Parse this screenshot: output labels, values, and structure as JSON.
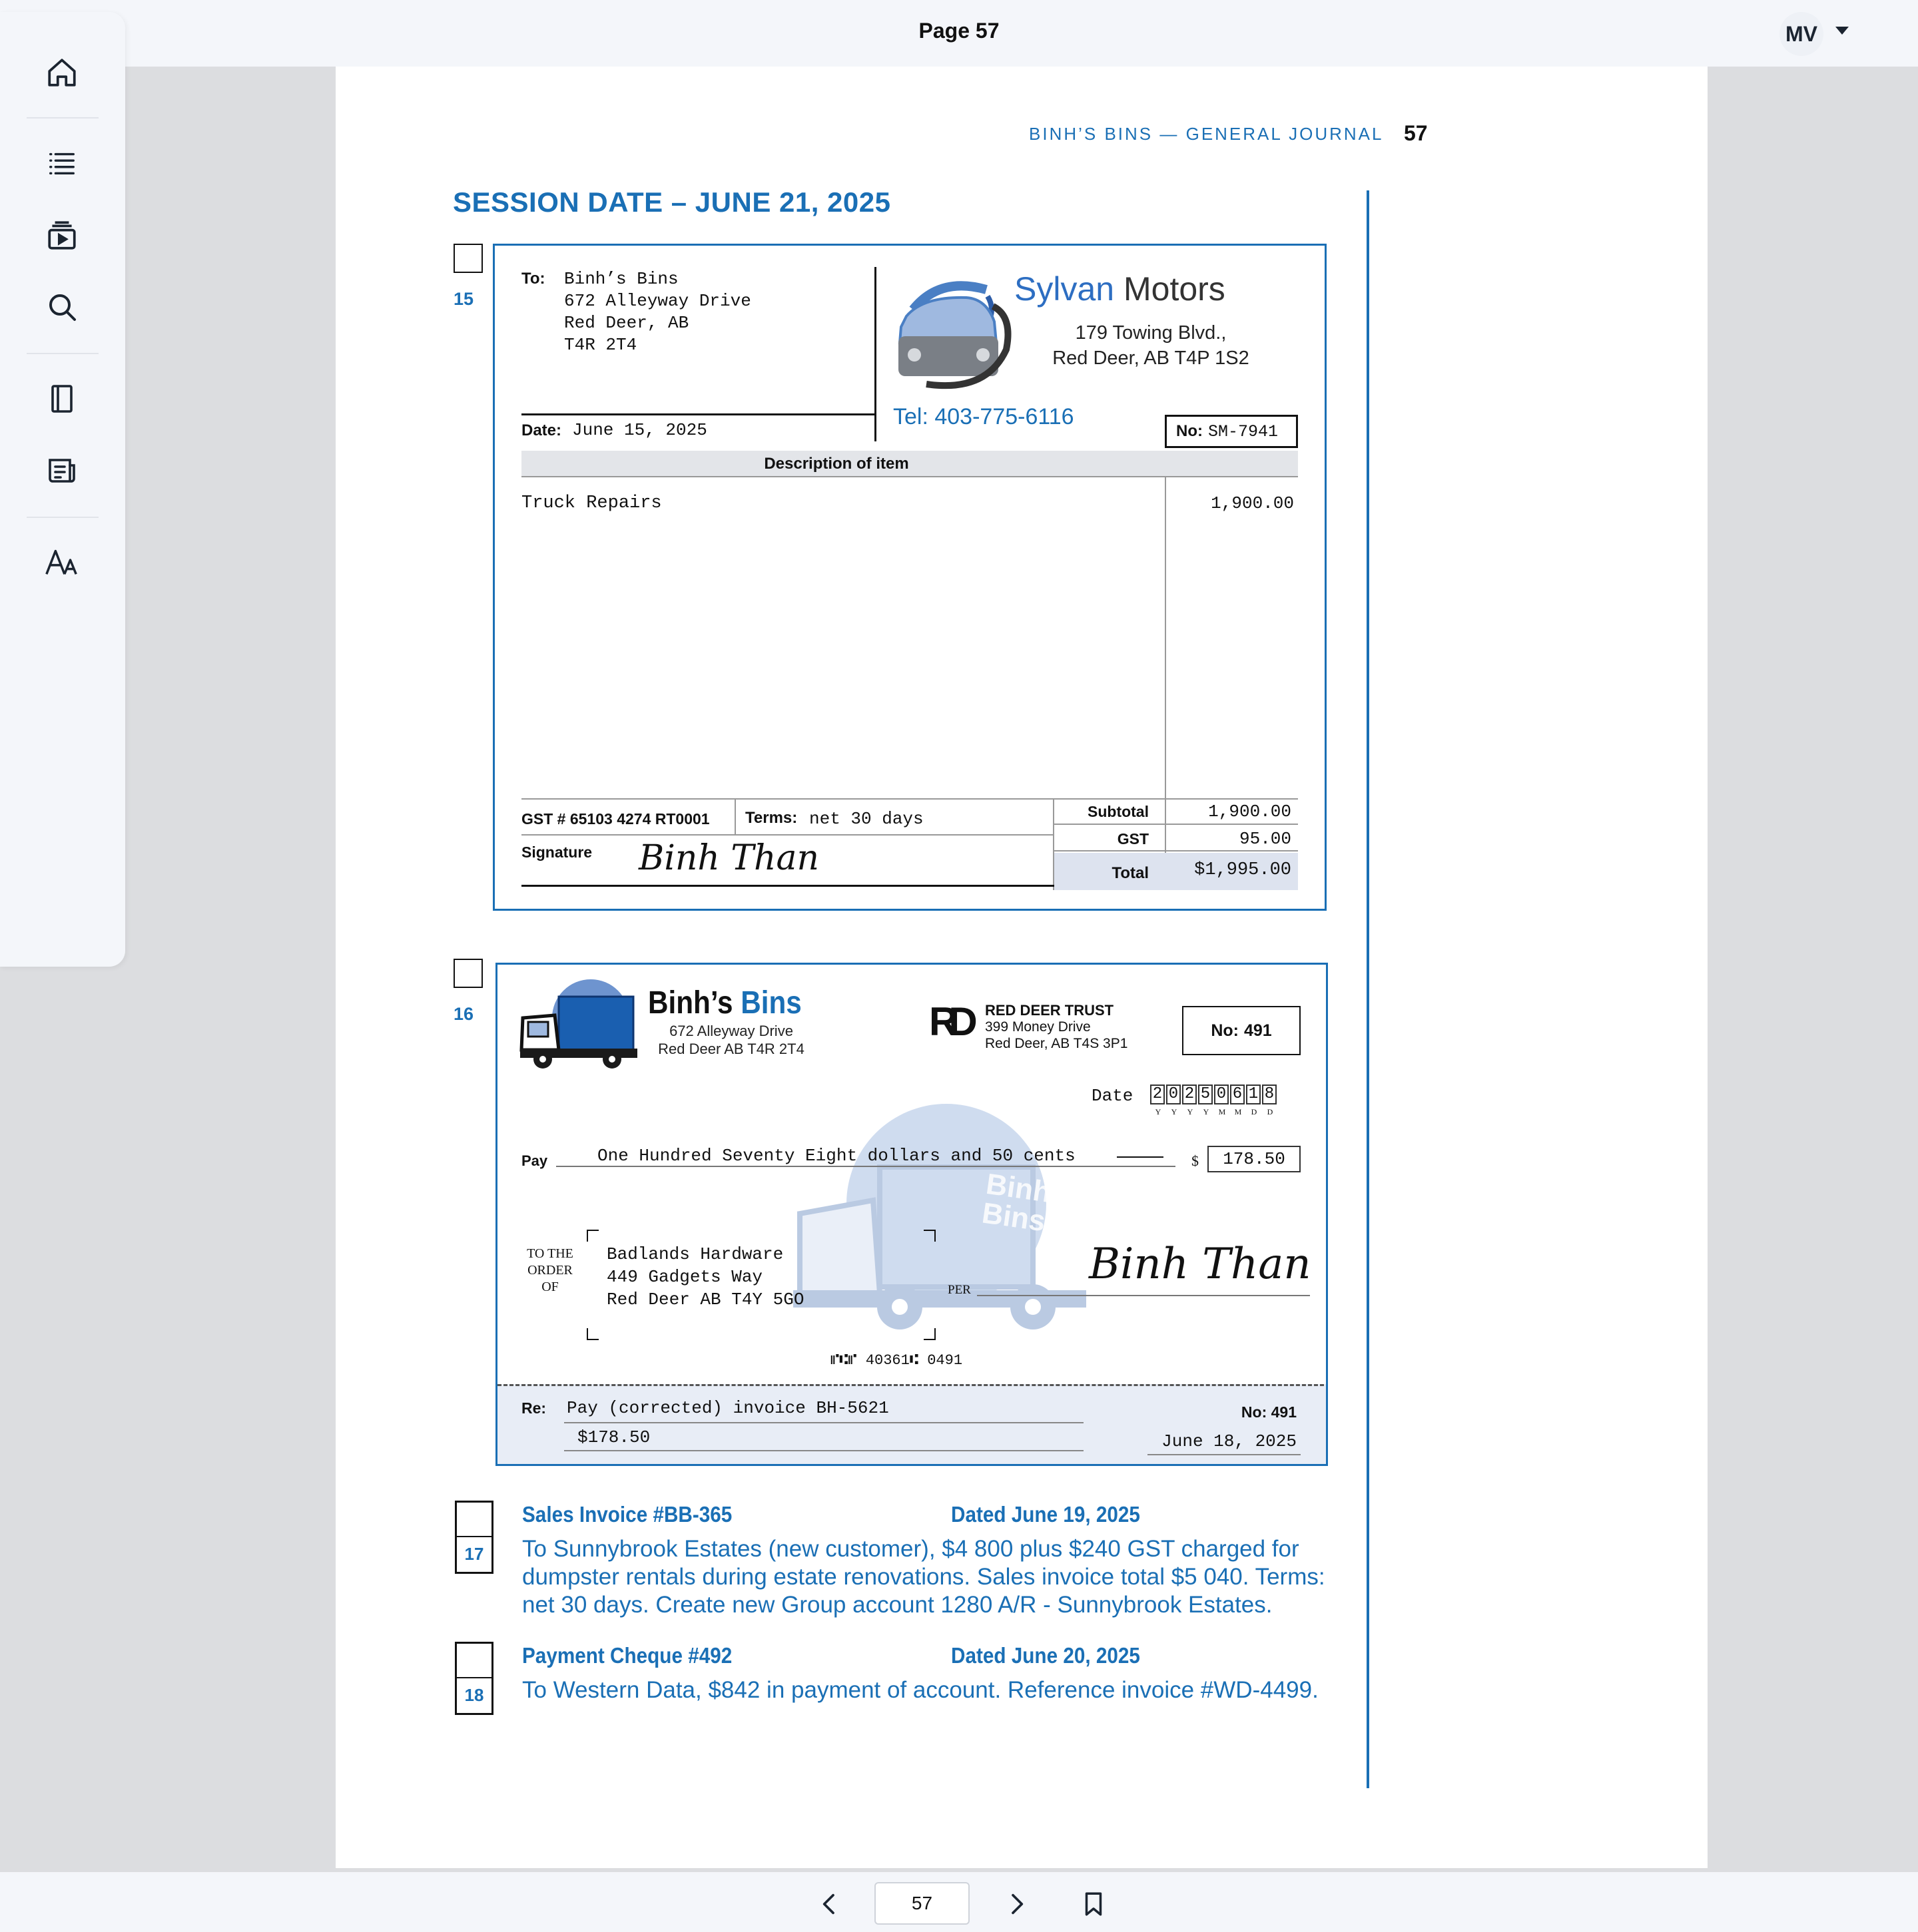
{
  "topbar": {
    "title": "Page 57",
    "avatar": "MV"
  },
  "bottombar": {
    "page_value": "57"
  },
  "sidebar": {
    "icons": [
      "home-icon",
      "list-icon",
      "media-icon",
      "search-icon",
      "notebook-icon",
      "notes-icon",
      "font-icon"
    ]
  },
  "doc": {
    "running_head": "BINH’S BINS — GENERAL JOURNAL",
    "page_number": "57",
    "session": "SESSION DATE – JUNE 21, 2025"
  },
  "invoice": {
    "item_no": "15",
    "to_label": "To:",
    "to_lines": [
      "Binh’s Bins",
      "672 Alleyway Drive",
      "Red Deer, AB",
      "T4R 2T4"
    ],
    "vendor_a": "Sylvan",
    "vendor_b": "Motors",
    "vendor_addr1": "179 Towing Blvd.,",
    "vendor_addr2": "Red Deer, AB T4P 1S2",
    "tel": "Tel: 403-775-6116",
    "date_label": "Date:",
    "date": "June 15, 2025",
    "no_label": "No:",
    "no": "SM-7941",
    "desc_header": "Description of item",
    "item": "Truck Repairs",
    "amount": "1,900.00",
    "gst_no": "GST # 65103 4274 RT0001",
    "terms_label": "Terms:",
    "terms": "net 30 days",
    "sig_label": "Signature",
    "signature": "Binh Than",
    "subtotal_label": "Subtotal",
    "subtotal": "1,900.00",
    "gst_label": "GST",
    "gst": "95.00",
    "total_label": "Total",
    "total": "$1,995.00"
  },
  "cheque": {
    "item_no": "16",
    "company_a": "Binh’s",
    "company_b": "Bins",
    "company_addr1": "672 Alleyway Drive",
    "company_addr2": "Red Deer AB  T4R 2T4",
    "truck_text": "Binh's Bins",
    "bank_logo": "RD",
    "bank": "RED DEER TRUST",
    "bank_addr1": "399 Money Drive",
    "bank_addr2": "Red Deer, AB T4S 3P1",
    "no_label": "No:",
    "no": "491",
    "date_label": "Date",
    "date_digits": [
      "2",
      "0",
      "2",
      "5",
      "0",
      "6",
      "1",
      "8"
    ],
    "date_format": [
      "Y",
      "Y",
      "Y",
      "Y",
      "M",
      "M",
      "D",
      "D"
    ],
    "pay_label": "Pay",
    "pay_words": "One Hundred Seventy Eight dollars and 50 cents",
    "dollar": "$",
    "amount": "178.50",
    "order_label_1": "TO THE",
    "order_label_2": "ORDER",
    "order_label_3": "OF",
    "payee": [
      "Badlands Hardware",
      "449 Gadgets Way",
      "Red Deer AB   T4Y 5GO"
    ],
    "per_label": "PER",
    "signature": "Binh Than",
    "micr": "⑈⑆⑈ 40361⑆ 0491",
    "re_label": "Re:",
    "re": "Pay (corrected) invoice BH-5621",
    "re_amount": "$178.50",
    "stub_no_label": "No:",
    "stub_no": "491",
    "stub_date": "June 18, 2025"
  },
  "transactions": [
    {
      "no": "17",
      "title": "Sales Invoice #BB-365",
      "dated": "Dated June 19, 2025",
      "body": "To Sunnybrook Estates (new customer), $4 800 plus $240 GST charged for dumpster rentals during estate renovations. Sales invoice total $5 040. Terms: net 30 days. Create new Group account 1280 A/R - Sunnybrook Estates."
    },
    {
      "no": "18",
      "title": "Payment Cheque #492",
      "dated": "Dated June 20, 2025",
      "body": "To Western Data, $842 in payment of account. Reference invoice #WD-4499."
    }
  ],
  "colors": {
    "accent": "#1a6fb5",
    "stub": "#e8edf6",
    "page_bg": "#dcdde0"
  }
}
